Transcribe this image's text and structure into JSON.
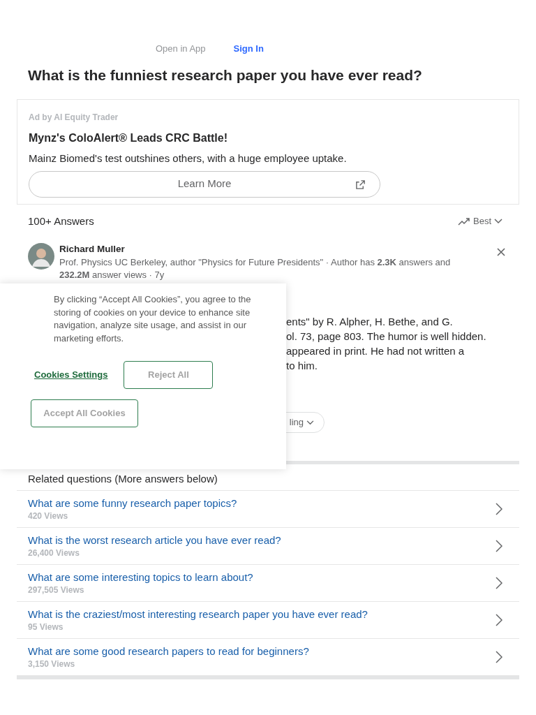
{
  "top_links": [
    {
      "label": "Open in App",
      "kind": "plain"
    },
    {
      "label": "Sign In",
      "kind": "primary"
    }
  ],
  "question": "What is the funniest research paper you have ever read?",
  "ad": {
    "sponsor": "Ad by AI Equity Trader",
    "headline": "Mynz's ColoAlert® Leads CRC Battle!",
    "text": "Mainz Biomed's test outshines others, with a huge employee uptake.",
    "button": "Learn More"
  },
  "answers_header": {
    "count": "100+ Answers",
    "sort": "Best"
  },
  "answer": {
    "author": "Richard Muller",
    "credentials": "Prof. Physics UC Berkeley, author \"Physics for Future Presidents\" · Author has **2.3K** answers and",
    "credentials_cut": "**232.2M** answer views · 7y",
    "visible_lines": [
      "ents\" by R. Alpher, H. Bethe, and G.",
      "ol. 73, page 803. The humor is well hidden.",
      "appeared in print. He had not written a",
      "to him."
    ],
    "pill": "ling"
  },
  "cookie_banner": {
    "text": "By clicking “Accept All Cookies”, you agree to the storing of cookies on your device to enhance site navigation, analyze site usage, and assist in our marketing efforts.",
    "settings": "Cookies Settings",
    "reject": "Reject All",
    "accept": "Accept All Cookies"
  },
  "related": {
    "title": "Related questions (More answers below)",
    "items": [
      {
        "question": "What are some funny research paper topics?",
        "views": "420 Views"
      },
      {
        "question": "What is the worst research article you have ever read?",
        "views": "26,400 Views"
      },
      {
        "question": "What are some interesting topics to learn about?",
        "views": "297,505 Views"
      },
      {
        "question": "What is the craziest/most interesting research paper you have ever read?",
        "views": "95 Views"
      },
      {
        "question": "What are some good research papers to read for beginners?",
        "views": "3,150 Views"
      }
    ]
  }
}
